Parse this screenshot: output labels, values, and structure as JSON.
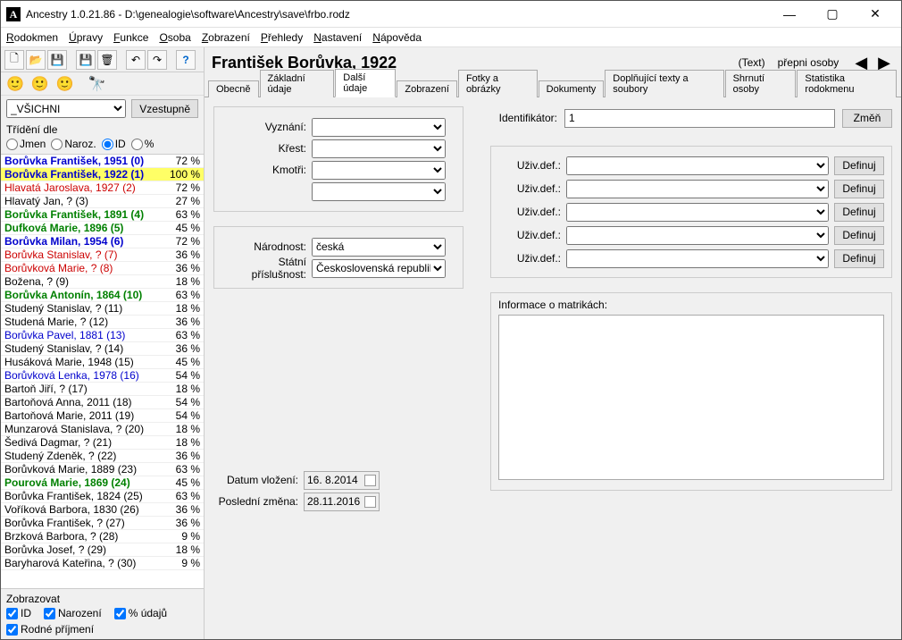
{
  "window": {
    "title": "Ancestry 1.0.21.86 - D:\\genealogie\\software\\Ancestry\\save\\frbo.rodz",
    "appicon": "A"
  },
  "menu": [
    "Rodokmen",
    "Úpravy",
    "Funkce",
    "Osoba",
    "Zobrazení",
    "Přehledy",
    "Nastavení",
    "Nápověda"
  ],
  "filter": {
    "value": "_VŠICHNI",
    "sort_button": "Vzestupně"
  },
  "sort": {
    "label": "Třídění dle",
    "opts": [
      "Jmen",
      "Naroz.",
      "ID",
      "%"
    ],
    "selected": "ID"
  },
  "persons": [
    {
      "name": "Borůvka František, 1951 (0)",
      "pct": "72 %",
      "cls": "c-blue"
    },
    {
      "name": "Borůvka František, 1922 (1)",
      "pct": "100 %",
      "cls": "c-blue",
      "sel": true
    },
    {
      "name": "Hlavatá Jaroslava, 1927 (2)",
      "pct": "72 %",
      "cls": "c-red"
    },
    {
      "name": "Hlavatý Jan, ? (3)",
      "pct": "27 %",
      "cls": "c-black"
    },
    {
      "name": "Borůvka František, 1891 (4)",
      "pct": "63 %",
      "cls": "c-green"
    },
    {
      "name": "Dufková Marie, 1896 (5)",
      "pct": "45 %",
      "cls": "c-green"
    },
    {
      "name": "Borůvka Milan, 1954 (6)",
      "pct": "72 %",
      "cls": "c-blue"
    },
    {
      "name": "Borůvka Stanislav, ? (7)",
      "pct": "36 %",
      "cls": "c-red"
    },
    {
      "name": "Borůvková Marie, ? (8)",
      "pct": "36 %",
      "cls": "c-red"
    },
    {
      "name": "Božena, ? (9)",
      "pct": "18 %",
      "cls": "c-black"
    },
    {
      "name": "Borůvka Antonín, 1864 (10)",
      "pct": "63 %",
      "cls": "c-green"
    },
    {
      "name": "Studený Stanislav, ? (11)",
      "pct": "18 %",
      "cls": "c-black"
    },
    {
      "name": "Studená Marie, ? (12)",
      "pct": "36 %",
      "cls": "c-black"
    },
    {
      "name": "Borůvka Pavel, 1881 (13)",
      "pct": "63 %",
      "cls": "c-blue2"
    },
    {
      "name": "Studený Stanislav, ? (14)",
      "pct": "36 %",
      "cls": "c-black"
    },
    {
      "name": "Husáková Marie, 1948 (15)",
      "pct": "45 %",
      "cls": "c-black"
    },
    {
      "name": "Borůvková Lenka, 1978 (16)",
      "pct": "54 %",
      "cls": "c-blue2"
    },
    {
      "name": "Bartoň Jiří, ? (17)",
      "pct": "18 %",
      "cls": "c-black"
    },
    {
      "name": "Bartoňová Anna, 2011 (18)",
      "pct": "54 %",
      "cls": "c-black"
    },
    {
      "name": "Bartoňová Marie, 2011 (19)",
      "pct": "54 %",
      "cls": "c-black"
    },
    {
      "name": "Munzarová Stanislava, ? (20)",
      "pct": "18 %",
      "cls": "c-black"
    },
    {
      "name": "Šedivá Dagmar, ? (21)",
      "pct": "18 %",
      "cls": "c-black"
    },
    {
      "name": "Studený Zdeněk, ? (22)",
      "pct": "36 %",
      "cls": "c-black"
    },
    {
      "name": "Borůvková Marie, 1889 (23)",
      "pct": "63 %",
      "cls": "c-black"
    },
    {
      "name": "Pourová Marie, 1869 (24)",
      "pct": "45 %",
      "cls": "c-green"
    },
    {
      "name": "Borůvka František, 1824 (25)",
      "pct": "63 %",
      "cls": "c-black"
    },
    {
      "name": "Voříková Barbora, 1830 (26)",
      "pct": "36 %",
      "cls": "c-black"
    },
    {
      "name": "Borůvka František, ? (27)",
      "pct": "36 %",
      "cls": "c-black"
    },
    {
      "name": "Brzková Barbora, ? (28)",
      "pct": "9 %",
      "cls": "c-black"
    },
    {
      "name": "Borůvka Josef, ? (29)",
      "pct": "18 %",
      "cls": "c-black"
    },
    {
      "name": "Baryharová Kateřina, ? (30)",
      "pct": "9 %",
      "cls": "c-black"
    }
  ],
  "display": {
    "title": "Zobrazovat",
    "checks": [
      {
        "label": "ID",
        "checked": true
      },
      {
        "label": "Narození",
        "checked": true
      },
      {
        "label": "% údajů",
        "checked": true
      },
      {
        "label": "Rodné příjmení",
        "checked": true
      }
    ]
  },
  "header": {
    "person": "František Borůvka, 1922",
    "text_link": "(Text)",
    "switch": "přepni osoby"
  },
  "tabs": [
    "Obecně",
    "Základní údaje",
    "Další údaje",
    "Zobrazení",
    "Fotky a obrázky",
    "Dokumenty",
    "Doplňující texty a soubory",
    "Shrnutí osoby",
    "Statistika rodokmenu"
  ],
  "active_tab": 2,
  "form": {
    "vyznani_label": "Vyznání:",
    "krest_label": "Křest:",
    "kmotri_label": "Kmotři:",
    "narodnost_label": "Národnost:",
    "narodnost_value": "česká",
    "prislusnost_label": "Státní příslušnost:",
    "prislusnost_value": "Československá republika",
    "vlozeni_label": "Datum vložení:",
    "vlozeni_value": "16.  8.2014",
    "zmena_label": "Poslední změna:",
    "zmena_value": "28.11.2016",
    "id_label": "Identifikátor:",
    "id_value": "1",
    "zmen_btn": "Změň",
    "uziv_label": "Uživ.def.:",
    "def_btn": "Definuj",
    "info_label": "Informace o matrikách:"
  }
}
